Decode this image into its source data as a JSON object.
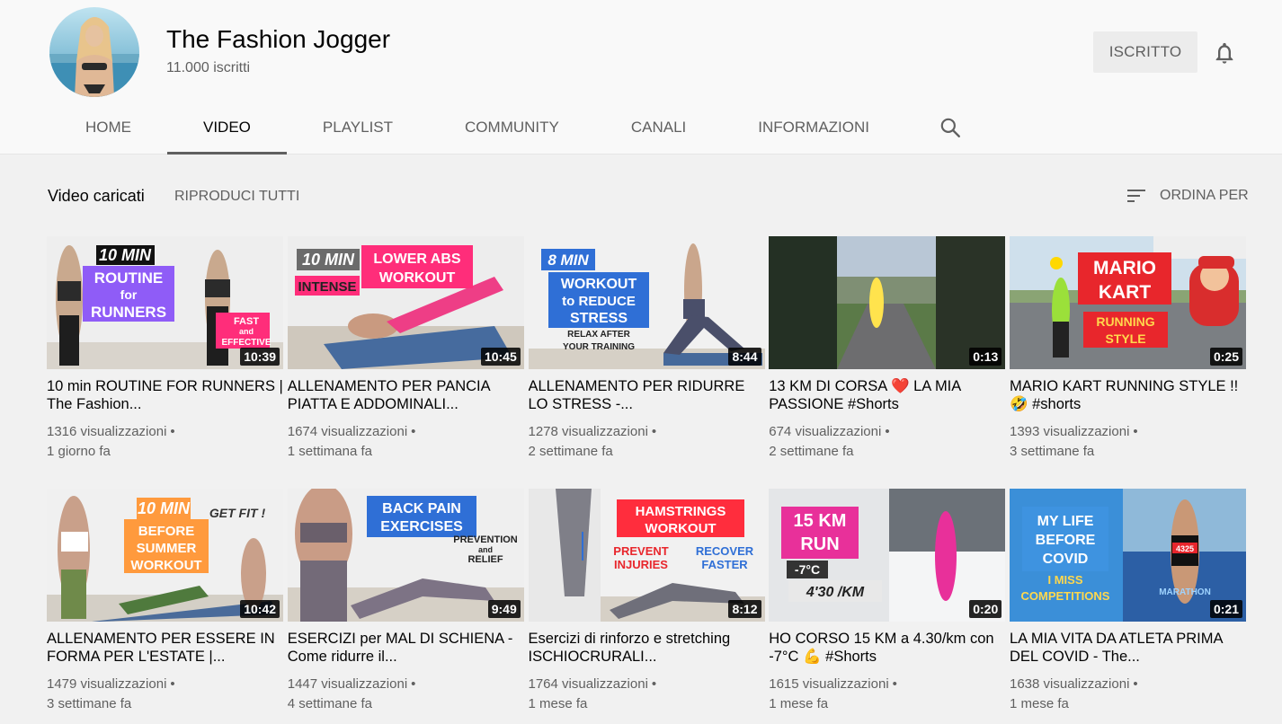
{
  "channel": {
    "name": "The Fashion Jogger",
    "subscribers": "11.000 iscritti",
    "subscribe_label": "ISCRITTO"
  },
  "tabs": [
    {
      "label": "HOME",
      "active": false
    },
    {
      "label": "VIDEO",
      "active": true
    },
    {
      "label": "PLAYLIST",
      "active": false
    },
    {
      "label": "COMMUNITY",
      "active": false
    },
    {
      "label": "CANALI",
      "active": false
    },
    {
      "label": "INFORMAZIONI",
      "active": false
    }
  ],
  "section": {
    "title": "Video caricati",
    "play_all": "RIPRODUCI TUTTI",
    "sort": "ORDINA PER"
  },
  "icons": {
    "bell": "bell-icon",
    "search": "search-icon",
    "sort": "sort-icon"
  },
  "videos": [
    {
      "title": "10 min ROUTINE FOR RUNNERS | The Fashion...",
      "views": "1316 visualizzazioni",
      "age": "1 giorno fa",
      "duration": "10:39",
      "thumb_text": [
        "10 MIN",
        "ROUTINE",
        "for",
        "RUNNERS",
        "FAST",
        "and",
        "EFFECTIVE"
      ]
    },
    {
      "title": "ALLENAMENTO PER PANCIA PIATTA E ADDOMINALI...",
      "views": "1674 visualizzazioni",
      "age": "1 settimana fa",
      "duration": "10:45",
      "thumb_text": [
        "10 MIN",
        "LOWER ABS",
        "WORKOUT",
        "INTENSE"
      ]
    },
    {
      "title": "ALLENAMENTO PER RIDURRE LO STRESS -...",
      "views": "1278 visualizzazioni",
      "age": "2 settimane fa",
      "duration": "8:44",
      "thumb_text": [
        "8 MIN",
        "WORKOUT",
        "to REDUCE",
        "STRESS",
        "RELAX AFTER",
        "YOUR TRAINING"
      ]
    },
    {
      "title": "13 KM DI CORSA ❤️ LA MIA PASSIONE #Shorts",
      "views": "674 visualizzazioni",
      "age": "2 settimane fa",
      "duration": "0:13",
      "thumb_text": []
    },
    {
      "title": "MARIO KART RUNNING STYLE !! 🤣 #shorts",
      "views": "1393 visualizzazioni",
      "age": "3 settimane fa",
      "duration": "0:25",
      "thumb_text": [
        "MARIO",
        "KART",
        "RUNNING",
        "STYLE"
      ]
    },
    {
      "title": "ALLENAMENTO PER ESSERE IN FORMA PER L'ESTATE |...",
      "views": "1479 visualizzazioni",
      "age": "3 settimane fa",
      "duration": "10:42",
      "thumb_text": [
        "10 MIN",
        "BEFORE",
        "SUMMER",
        "WORKOUT",
        "GET FIT !"
      ]
    },
    {
      "title": "ESERCIZI per MAL DI SCHIENA - Come ridurre il...",
      "views": "1447 visualizzazioni",
      "age": "4 settimane fa",
      "duration": "9:49",
      "thumb_text": [
        "BACK PAIN",
        "EXERCISES",
        "PREVENTION",
        "and",
        "RELIEF"
      ]
    },
    {
      "title": "Esercizi di rinforzo e stretching ISCHIOCRURALI...",
      "views": "1764 visualizzazioni",
      "age": "1 mese fa",
      "duration": "8:12",
      "thumb_text": [
        "HAMSTRINGS",
        "WORKOUT",
        "PREVENT",
        "INJURIES",
        "RECOVER",
        "FASTER"
      ]
    },
    {
      "title": "HO CORSO 15 KM a 4.30/km con -7°C 💪 #Shorts",
      "views": "1615 visualizzazioni",
      "age": "1 mese fa",
      "duration": "0:20",
      "thumb_text": [
        "15 KM",
        "RUN",
        "-7°C",
        "4'30 /KM"
      ]
    },
    {
      "title": "LA MIA VITA DA ATLETA PRIMA DEL COVID - The...",
      "views": "1638 visualizzazioni",
      "age": "1 mese fa",
      "duration": "0:21",
      "thumb_text": [
        "MY LIFE",
        "BEFORE",
        "COVID",
        "I MISS",
        "COMPETITIONS",
        "4325",
        "MARATHON"
      ]
    }
  ],
  "colors": {
    "accent_purple": "#8f5cf7",
    "accent_pink": "#ff2d7a",
    "accent_red": "#e8262c",
    "accent_blue": "#2f6fd6",
    "accent_orange": "#ff9a3d"
  }
}
